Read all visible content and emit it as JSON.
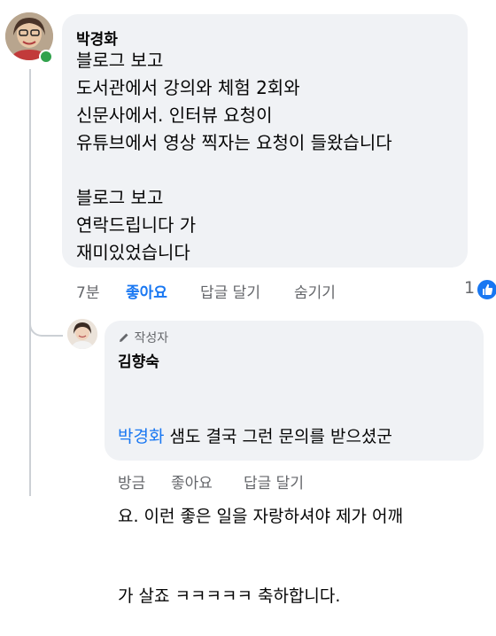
{
  "comment": {
    "author": "박경화",
    "body": "블로그 보고\n도서관에서 강의와 체험 2회와\n신문사에서. 인터뷰 요청이\n유튜브에서 영상 찍자는 요청이 들왔습니다\n\n블로그 보고\n연락드립니다 가\n재미있었습니다",
    "time": "7분",
    "like_label": "좋아요",
    "reply_label": "답글 달기",
    "hide_label": "숨기기",
    "reaction_count": "1"
  },
  "reply": {
    "badge_label": "작성자",
    "author": "김향숙",
    "mention": "박경화",
    "text_line1": " 샘도 결국 그런 문의를 받으셨군",
    "text_line2": "요. 이런 좋은 일을 자랑하셔야 제가 어깨",
    "text_line3": "가 살죠 ㅋㅋㅋㅋㅋ 축하합니다.",
    "time": "방금",
    "like_label": "좋아요",
    "reply_label": "답글 달기"
  },
  "colors": {
    "bubble": "#f0f2f5",
    "link": "#1877f2",
    "muted": "#65676b",
    "online": "#31a24c"
  },
  "icons": {
    "like_reaction": "thumbs-up-icon",
    "author_badge": "pencil-icon"
  }
}
